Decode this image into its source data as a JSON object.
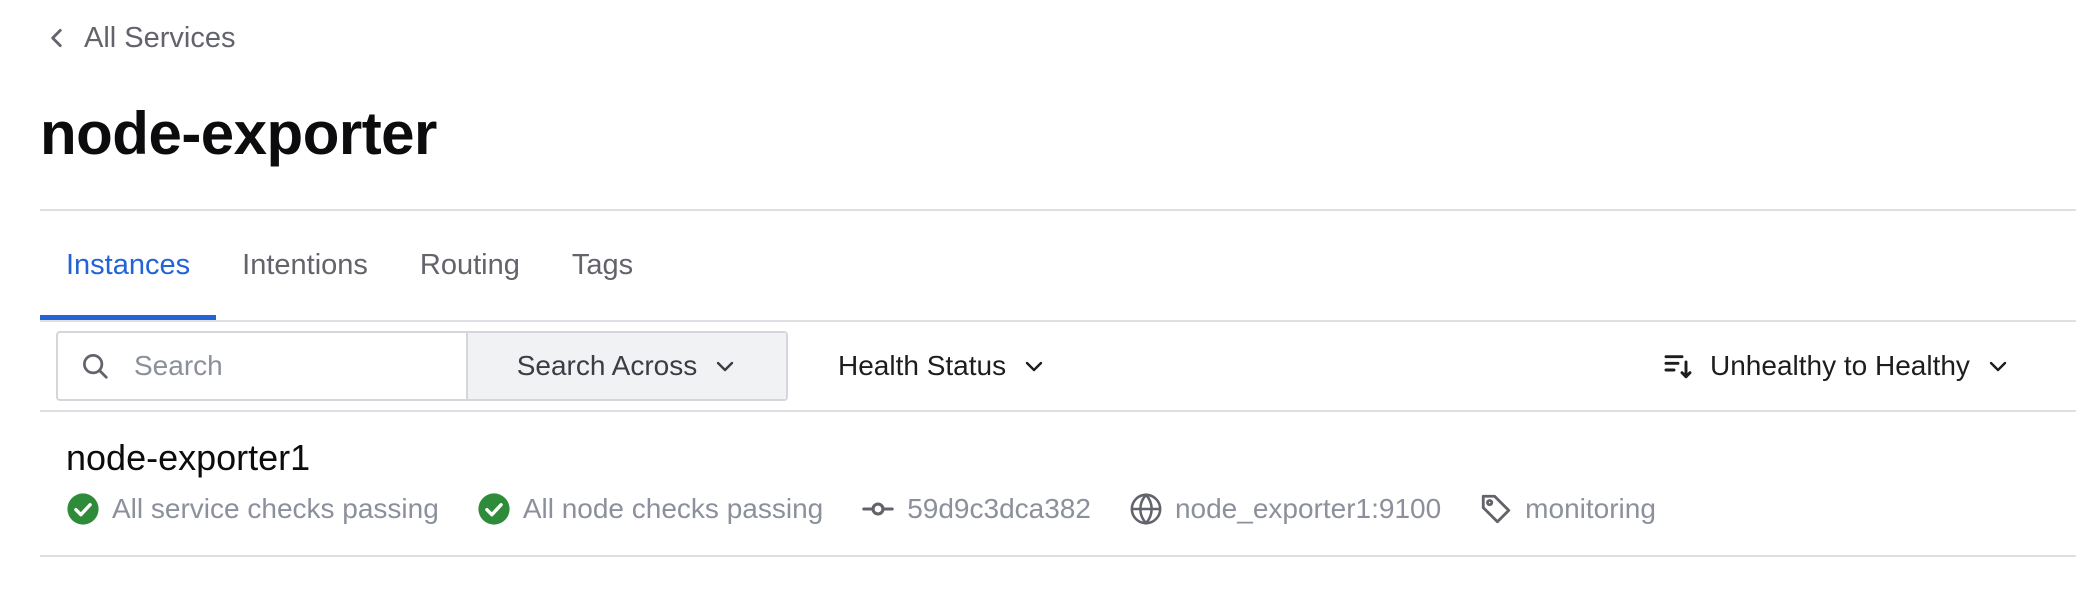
{
  "breadcrumb": {
    "label": "All Services"
  },
  "page": {
    "title": "node-exporter"
  },
  "tabs": [
    {
      "label": "Instances",
      "active": true
    },
    {
      "label": "Intentions",
      "active": false
    },
    {
      "label": "Routing",
      "active": false
    },
    {
      "label": "Tags",
      "active": false
    }
  ],
  "toolbar": {
    "search_placeholder": "Search",
    "search_across_label": "Search Across",
    "health_status_label": "Health Status",
    "sort_label": "Unhealthy to Healthy"
  },
  "instances": [
    {
      "name": "node-exporter1",
      "service_checks": "All service checks passing",
      "node_checks": "All node checks passing",
      "node_id": "59d9c3dca382",
      "address": "node_exporter1:9100",
      "tag": "monitoring"
    }
  ],
  "colors": {
    "accent": "#2264d6",
    "passing": "#2eb039",
    "muted_text": "#8c909c"
  },
  "icons": [
    "chevron-left-icon",
    "search-icon",
    "chevron-down-icon",
    "sort-icon",
    "check-circle-icon",
    "git-commit-icon",
    "globe-icon",
    "tag-icon"
  ]
}
